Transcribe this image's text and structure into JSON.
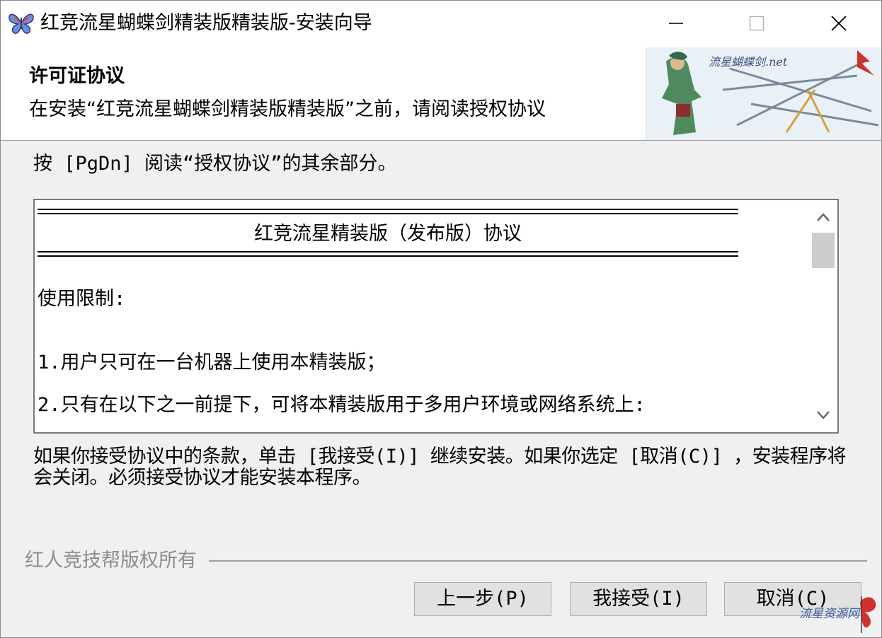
{
  "window": {
    "title": "红竞流星蝴蝶剑精装版精装版-安装向导"
  },
  "header": {
    "title": "许可证协议",
    "subtitle": "在安装“红竞流星蝴蝶剑精装版精装版”之前，请阅读授权协议",
    "banner_text": "流星蝴蝶剑.net"
  },
  "instruction": "按 [PgDn] 阅读“授权协议”的其余部分。",
  "license": {
    "heading": "红竞流星精装版（发布版）协议",
    "lines": [
      "使用限制:",
      "1.用户只可在一台机器上使用本精装版；",
      "2.只有在以下之一前提下，可将本精装版用于多用户环境或网络系统上:"
    ]
  },
  "notice": "如果你接受协议中的条款，单击 [我接受(I)] 继续安装。如果你选定 [取消(C)] ，安装程序将会关闭。必须接受协议才能安装本程序。",
  "branding": "红人竞技帮版权所有",
  "buttons": {
    "back": "上一步(P)",
    "accept": "我接受(I)",
    "cancel": "取消(C)"
  },
  "watermark": "流星资源网",
  "icons": {
    "app": "butterfly-icon",
    "minimize": "minimize-icon",
    "maximize": "maximize-icon",
    "close": "close-icon",
    "scroll_up": "chevron-up-icon",
    "scroll_down": "chevron-down-icon"
  }
}
